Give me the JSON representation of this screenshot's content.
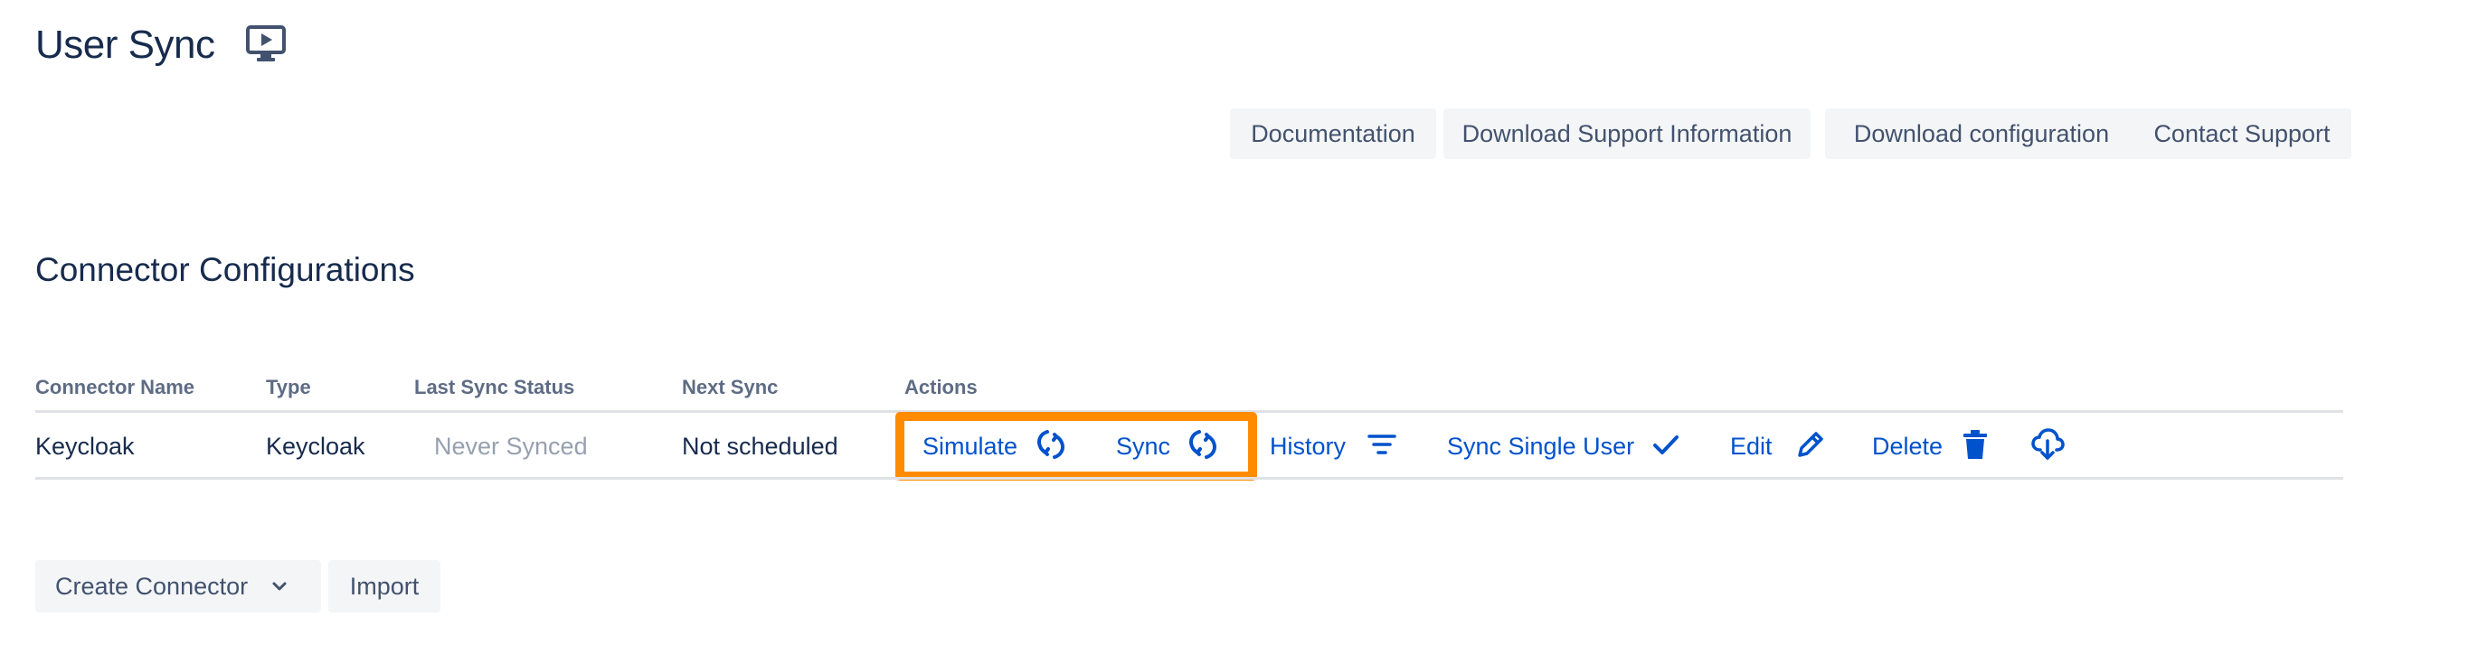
{
  "header": {
    "title": "User Sync",
    "title_icon": "monitor-play-icon"
  },
  "toolbar": {
    "buttons": [
      {
        "label": "Documentation"
      },
      {
        "label": "Download Support Information"
      },
      {
        "label": "Download configuration"
      },
      {
        "label": "Contact Support"
      }
    ]
  },
  "section": {
    "title": "Connector Configurations"
  },
  "table": {
    "columns": [
      "Connector Name",
      "Type",
      "Last Sync Status",
      "Next Sync",
      "Actions"
    ],
    "rows": [
      {
        "name": "Keycloak",
        "type": "Keycloak",
        "last_sync_status": "Never Synced",
        "next_sync": "Not scheduled",
        "actions": [
          {
            "label": "Simulate",
            "icon": "refresh-icon"
          },
          {
            "label": "Sync",
            "icon": "refresh-icon"
          },
          {
            "label": "History",
            "icon": "filter-icon"
          },
          {
            "label": "Sync Single User",
            "icon": "check-icon"
          },
          {
            "label": "Edit",
            "icon": "pencil-icon"
          },
          {
            "label": "Delete",
            "icon": "trash-icon"
          },
          {
            "label": "",
            "icon": "cloud-download-icon"
          }
        ]
      }
    ]
  },
  "footer": {
    "create_label": "Create Connector",
    "create_icon": "chevron-down-icon",
    "import_label": "Import"
  },
  "colors": {
    "text": "#172b4d",
    "link": "#0052cc",
    "muted": "#97a0af",
    "header_text": "#5e6c84",
    "button_bg": "#f4f5f7",
    "highlight": "#ff8b00",
    "divider": "#dfe1e6"
  }
}
